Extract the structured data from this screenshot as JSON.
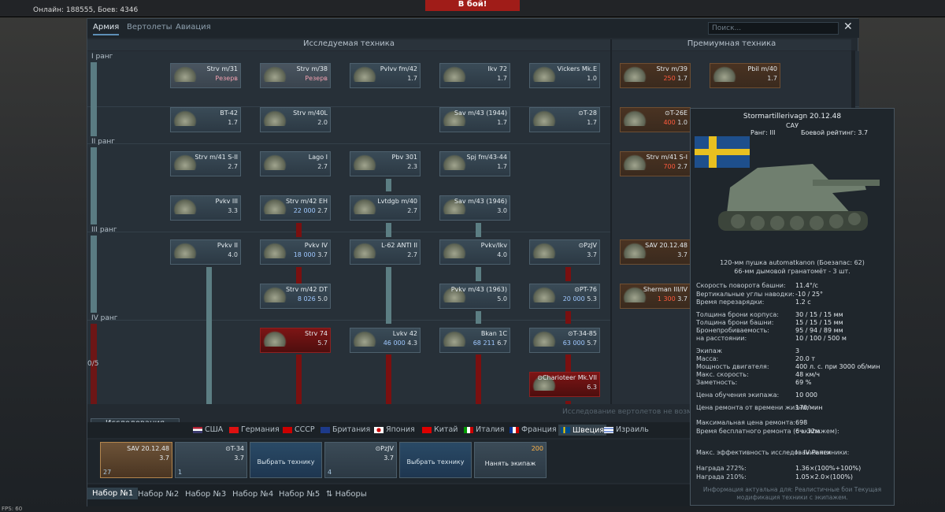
{
  "topbar": {
    "online": "Онлайн: 188555, Боев: 4346",
    "battle": "В бой!"
  },
  "window": {
    "tabs": [
      "Армия",
      "Вертолеты",
      "Авиация"
    ],
    "search_placeholder": "Поиск...",
    "close": "✕",
    "section_researched": "Исследуемая техника",
    "section_premium": "Премиумная техника"
  },
  "ranks": [
    "I ранг",
    "II ранг",
    "III ранг",
    "IV ранг"
  ],
  "rank_progress": "0/5",
  "tree": [
    {
      "name": "Strv m/31",
      "value": "Резерв",
      "kind": "reserve"
    },
    {
      "name": "Strv m/38",
      "value": "Резерв",
      "kind": "reserve"
    },
    {
      "name": "Pvlvv fm/42",
      "value": "1.7",
      "kind": "normal"
    },
    {
      "name": "Ikv 72",
      "value": "1.7",
      "kind": "normal"
    },
    {
      "name": "Vickers Mk.E",
      "value": "1.0",
      "kind": "normal"
    },
    {
      "name": "BT-42",
      "value": "1.7",
      "kind": "normal"
    },
    {
      "name": "Strv m/40L",
      "value": "2.0",
      "kind": "normal"
    },
    {
      "name": "Sav m/43 (1944)",
      "value": "1.7",
      "kind": "normal"
    },
    {
      "name": "⊙T-28",
      "value": "1.7",
      "kind": "normal"
    },
    {
      "name": "Strv m/41 S-II",
      "value": "2.7",
      "kind": "normal"
    },
    {
      "name": "Lago I",
      "value": "2.7",
      "kind": "normal"
    },
    {
      "name": "Pbv 301",
      "value": "2.3",
      "kind": "normal"
    },
    {
      "name": "Spj fm/43-44",
      "value": "1.7",
      "kind": "normal"
    },
    {
      "name": "Pvkv III",
      "value": "3.3",
      "kind": "normal"
    },
    {
      "name": "Strv m/42 EH",
      "value": "22 000",
      "value2": "2.7",
      "kind": "normal"
    },
    {
      "name": "Lvtdgb m/40",
      "value": "2.7",
      "kind": "normal"
    },
    {
      "name": "Sav m/43 (1946)",
      "value": "3.0",
      "kind": "normal"
    },
    {
      "name": "Pvkv II",
      "value": "4.0",
      "kind": "normal"
    },
    {
      "name": "Pvkv IV",
      "value": "18 000",
      "value2": "3.7",
      "kind": "normal"
    },
    {
      "name": "L-62 ANTI II",
      "value": "2.7",
      "kind": "normal"
    },
    {
      "name": "Pvkv/Ikv",
      "value": "4.0",
      "kind": "normal"
    },
    {
      "name": "⊙PzJV",
      "value": "3.7",
      "kind": "normal"
    },
    {
      "name": "Strv m/42 DT",
      "value": "8 026",
      "value2": "5.0",
      "kind": "normal"
    },
    {
      "name": "Pvkv m/43 (1963)",
      "value": "5.0",
      "kind": "normal"
    },
    {
      "name": "⊙PT-76",
      "value": "20 000",
      "value2": "5.3",
      "kind": "normal"
    },
    {
      "name": "Strv 74",
      "value": "5.7",
      "kind": "red"
    },
    {
      "name": "Lvkv 42",
      "value": "46 000",
      "value2": "4.3",
      "kind": "normal"
    },
    {
      "name": "Bkan 1C",
      "value": "68 211",
      "value2": "6.7",
      "kind": "normal"
    },
    {
      "name": "⊙T-34-85",
      "value": "63 000",
      "value2": "5.7",
      "kind": "normal"
    },
    {
      "name": "⊙Charioteer Mk.VII",
      "value": "6.3",
      "kind": "red"
    }
  ],
  "premium": [
    {
      "name": "Strv m/39",
      "value": "250",
      "value2": "1.7"
    },
    {
      "name": "Pbil m/40",
      "value": "1.7"
    },
    {
      "name": "⊙T-26E",
      "value": "400",
      "value2": "1.0"
    },
    {
      "name": "Strv m/41 S-I",
      "value": "700",
      "value2": "2.7"
    },
    {
      "name": "SAV 20.12.48",
      "value": "3.7"
    },
    {
      "name": "Sherman III/IV",
      "value": "1 300",
      "value2": "3.7"
    }
  ],
  "research_button": "Исследования",
  "helicopter_notice": "Исследование вертолетов не возможно",
  "nations": [
    "США",
    "Германия",
    "СССР",
    "Британия",
    "Япония",
    "Китай",
    "Италия",
    "Франция",
    "Швеция",
    "Израиль"
  ],
  "crew": [
    {
      "name": "SAV 20.12.48",
      "value": "3.7",
      "foot": "27"
    },
    {
      "name": "⊙T-34",
      "value": "3.7",
      "foot": "1"
    },
    {
      "name": "",
      "value": "",
      "center": "Выбрать технику"
    },
    {
      "name": "⊙PzJV",
      "value": "3.7",
      "foot": "4"
    },
    {
      "name": "",
      "value": "",
      "center": "Выбрать технику"
    },
    {
      "name": "200",
      "value": "",
      "center": "Нанять экипаж"
    }
  ],
  "presets": [
    "Набор №1",
    "Набор №2",
    "Набор №3",
    "Набор №4",
    "Набор №5",
    "Наборы"
  ],
  "tooltip": {
    "title": "Stormartillerivagn 20.12.48",
    "sub": "САУ",
    "rank": "Ранг: III",
    "br": "Боевой рейтинг: 3.7",
    "gun1": "120-мм пушка automatkanon (Боезапас: 62)",
    "gun2": "66-мм дымовой гранатомёт - 3 шт.",
    "stats": [
      [
        "Скорость поворота башни:",
        "11.4°/с"
      ],
      [
        "Вертикальные углы наводки:",
        "-10 / 25°"
      ],
      [
        "Время перезарядки:",
        "1.2 с"
      ],
      [
        "Толщина брони корпуса:",
        "30 / 15 / 15 мм"
      ],
      [
        "Толщина брони башни:",
        "15 / 15 / 15 мм"
      ],
      [
        "Бронепробиваемость:",
        "95 / 94 / 89 мм"
      ],
      [
        "на расстоянии:",
        "10 / 100 / 500 м"
      ],
      [
        "Экипаж",
        "3"
      ],
      [
        "Масса:",
        "20.0 т"
      ],
      [
        "Мощность двигателя:",
        "400 л. с. при 3000 об/мин"
      ],
      [
        "Макс. скорость:",
        "48 км/ч"
      ],
      [
        "Заметность:",
        "69 %"
      ],
      [
        "Цена обучения экипажа:",
        "10 000"
      ],
      [
        "Цена ремонта от времени жизни:",
        "170/мин"
      ],
      [
        "Максимальная цена ремонта:",
        "698"
      ],
      [
        "Время бесплатного ремонта (с экипажем):",
        "6ч. 32м."
      ],
      [
        "Макс. эффективность исследования техники:",
        "I - IV Ранги"
      ],
      [
        "Награда 272%:",
        "1.36×(100%+100%)"
      ],
      [
        "Награда 210%:",
        "1.05×2.0×(100%)"
      ]
    ],
    "foot": "Информация актуальна для: Реалистичные бои Текущая модификация техники с экипажем."
  },
  "fps": "FPS: 60"
}
